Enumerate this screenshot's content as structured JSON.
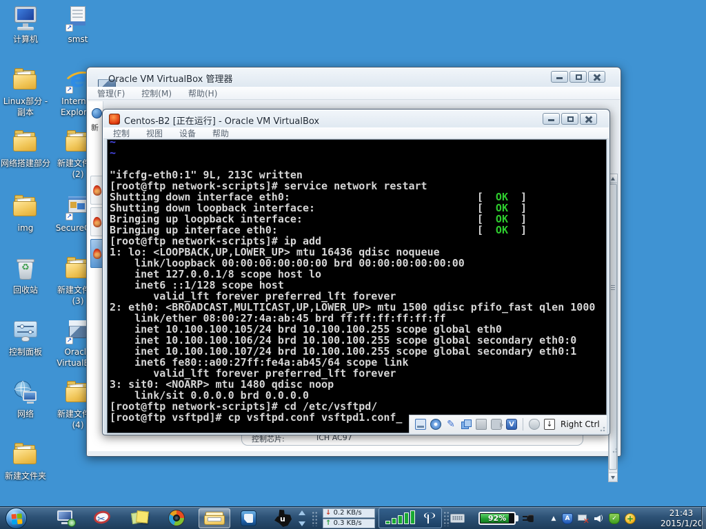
{
  "desktop": {
    "bg_color": "#3f93d3",
    "icons": [
      {
        "id": "computer",
        "type": "computer",
        "col": 0,
        "row": 0,
        "lines": [
          "计算机"
        ],
        "shortcut": false
      },
      {
        "id": "smst",
        "type": "page",
        "col": 1,
        "row": 0,
        "lines": [
          "smst"
        ],
        "shortcut": true
      },
      {
        "id": "linux-folder",
        "type": "folder",
        "col": 0,
        "row": 1,
        "lines": [
          "Linux部分 -",
          "副本"
        ],
        "shortcut": false
      },
      {
        "id": "internet-explorer",
        "type": "ie",
        "col": 1,
        "row": 1,
        "lines": [
          "Internet",
          "Explorer"
        ],
        "shortcut": true
      },
      {
        "id": "network-build-folder",
        "type": "folder",
        "col": 0,
        "row": 2,
        "lines": [
          "网络搭建部分"
        ],
        "shortcut": false
      },
      {
        "id": "new-folder-2",
        "type": "folder",
        "col": 1,
        "row": 2,
        "lines": [
          "新建文件夹",
          "(2)"
        ],
        "shortcut": false
      },
      {
        "id": "img-folder",
        "type": "folder",
        "col": 0,
        "row": 3,
        "lines": [
          "img"
        ],
        "shortcut": false
      },
      {
        "id": "securecrt",
        "type": "crt",
        "col": 1,
        "row": 3,
        "lines": [
          "SecureCRT"
        ],
        "shortcut": true
      },
      {
        "id": "recycle-bin",
        "type": "bin",
        "col": 0,
        "row": 4,
        "lines": [
          "回收站"
        ],
        "shortcut": false
      },
      {
        "id": "new-folder-3",
        "type": "folder",
        "col": 1,
        "row": 4,
        "lines": [
          "新建文件夹",
          "(3)"
        ],
        "shortcut": false
      },
      {
        "id": "control-panel",
        "type": "panel",
        "col": 0,
        "row": 5,
        "lines": [
          "控制面板"
        ],
        "shortcut": false
      },
      {
        "id": "oracle-virtualbox",
        "type": "cube",
        "col": 1,
        "row": 5,
        "lines": [
          "Oracle",
          "VirtualBox"
        ],
        "shortcut": true
      },
      {
        "id": "network",
        "type": "net",
        "col": 0,
        "row": 6,
        "lines": [
          "网络"
        ],
        "shortcut": false
      },
      {
        "id": "new-folder-4",
        "type": "folder",
        "col": 1,
        "row": 6,
        "lines": [
          "新建文件夹",
          "(4)"
        ],
        "shortcut": false
      },
      {
        "id": "new-folder",
        "type": "folder",
        "col": 0,
        "row": 7,
        "lines": [
          "新建文件夹"
        ],
        "shortcut": false
      }
    ],
    "shortcut_arrow_glyph": "↗"
  },
  "manager_window": {
    "title": "Oracle VM VirtualBox 管理器",
    "menu": [
      "管理(F)",
      "控制(M)",
      "帮助(H)"
    ],
    "toolbar_partial_label": "新",
    "vm_list": [
      {
        "id": "vm-1",
        "selected": false
      },
      {
        "id": "vm-2",
        "selected": false
      },
      {
        "id": "vm-3",
        "selected": true
      }
    ],
    "details_audio": {
      "label": "控制芯片:",
      "value": "ICH AC97"
    }
  },
  "vm_window": {
    "title": "Centos-B2 [正在运行] - Oracle VM VirtualBox",
    "menu": [
      "控制",
      "视图",
      "设备",
      "帮助"
    ],
    "statusbar": {
      "icons": [
        "harddisk-icon",
        "optical-disc-icon",
        "network-pen-icon",
        "shared-clipboard-icon",
        "shared-folder-icon",
        "video-capture-icon",
        "usb-icon"
      ],
      "mouse_icon": "mouse-integration-icon",
      "hostkey_icon_glyph": "↓",
      "hostkey_label": "Right Ctrl",
      "usb_glyph": "V"
    }
  },
  "terminal": {
    "colors": {
      "w": "#d6d6d6",
      "g": "#2ecc2e",
      "b": "#4848e8",
      "bg": "#000000"
    },
    "lines": [
      [
        {
          "t": "~",
          "c": "b"
        }
      ],
      [
        {
          "t": "~",
          "c": "b"
        }
      ],
      [],
      [
        {
          "t": "\"ifcfg-eth0:1\" 9L, 213C written",
          "c": "w"
        }
      ],
      [
        {
          "t": "[root@ftp network-scripts]# service network restart",
          "c": "w"
        }
      ],
      [
        {
          "t": "Shutting down interface eth0:                              [  ",
          "c": "w"
        },
        {
          "t": "OK",
          "c": "g"
        },
        {
          "t": "  ]",
          "c": "w"
        }
      ],
      [
        {
          "t": "Shutting down loopback interface:                          [  ",
          "c": "w"
        },
        {
          "t": "OK",
          "c": "g"
        },
        {
          "t": "  ]",
          "c": "w"
        }
      ],
      [
        {
          "t": "Bringing up loopback interface:                            [  ",
          "c": "w"
        },
        {
          "t": "OK",
          "c": "g"
        },
        {
          "t": "  ]",
          "c": "w"
        }
      ],
      [
        {
          "t": "Bringing up interface eth0:                                [  ",
          "c": "w"
        },
        {
          "t": "OK",
          "c": "g"
        },
        {
          "t": "  ]",
          "c": "w"
        }
      ],
      [
        {
          "t": "[root@ftp network-scripts]# ip add",
          "c": "w"
        }
      ],
      [
        {
          "t": "1: lo: <LOOPBACK,UP,LOWER_UP> mtu 16436 qdisc noqueue",
          "c": "w"
        }
      ],
      [
        {
          "t": "    link/loopback 00:00:00:00:00:00 brd 00:00:00:00:00:00",
          "c": "w"
        }
      ],
      [
        {
          "t": "    inet 127.0.0.1/8 scope host lo",
          "c": "w"
        }
      ],
      [
        {
          "t": "    inet6 ::1/128 scope host",
          "c": "w"
        }
      ],
      [
        {
          "t": "       valid_lft forever preferred_lft forever",
          "c": "w"
        }
      ],
      [
        {
          "t": "2: eth0: <BROADCAST,MULTICAST,UP,LOWER_UP> mtu 1500 qdisc pfifo_fast qlen 1000",
          "c": "w"
        }
      ],
      [
        {
          "t": "    link/ether 08:00:27:4a:ab:45 brd ff:ff:ff:ff:ff:ff",
          "c": "w"
        }
      ],
      [
        {
          "t": "    inet 10.100.100.105/24 brd 10.100.100.255 scope global eth0",
          "c": "w"
        }
      ],
      [
        {
          "t": "    inet 10.100.100.106/24 brd 10.100.100.255 scope global secondary eth0:0",
          "c": "w"
        }
      ],
      [
        {
          "t": "    inet 10.100.100.107/24 brd 10.100.100.255 scope global secondary eth0:1",
          "c": "w"
        }
      ],
      [
        {
          "t": "    inet6 fe80::a00:27ff:fe4a:ab45/64 scope link",
          "c": "w"
        }
      ],
      [
        {
          "t": "       valid_lft forever preferred_lft forever",
          "c": "w"
        }
      ],
      [
        {
          "t": "3: sit0: <NOARP> mtu 1480 qdisc noop",
          "c": "w"
        }
      ],
      [
        {
          "t": "    link/sit 0.0.0.0 brd 0.0.0.0",
          "c": "w"
        }
      ],
      [
        {
          "t": "[root@ftp network-scripts]# cd /etc/vsftpd/",
          "c": "w"
        }
      ],
      [
        {
          "t": "[root@ftp vsftpd]# cp vsftpd.conf vsftpd1.conf",
          "c": "w"
        },
        {
          "t": "_",
          "c": "w"
        }
      ]
    ]
  },
  "taskbar": {
    "pinned": [
      "remote-desktop",
      "snipping-tool",
      "sticky-notes",
      "media-app",
      "windows-explorer",
      "vmware-workstation",
      "texas-tool"
    ],
    "active_item": "windows-explorer",
    "net_down_label": "0.2 KB/s",
    "net_up_label": "0.3 KB/s",
    "net_down_arrow": "↓",
    "net_up_arrow": "↑",
    "battery_percent": "92%",
    "tray_icons": [
      "hidden-icons-arrow",
      "security-shield-blue",
      "network-disconnected",
      "volume",
      "security-shield-green",
      "antivirus-orb"
    ],
    "tray_up_glyph": "▲",
    "clock_time": "21:43",
    "clock_date": "2015/1/20"
  }
}
